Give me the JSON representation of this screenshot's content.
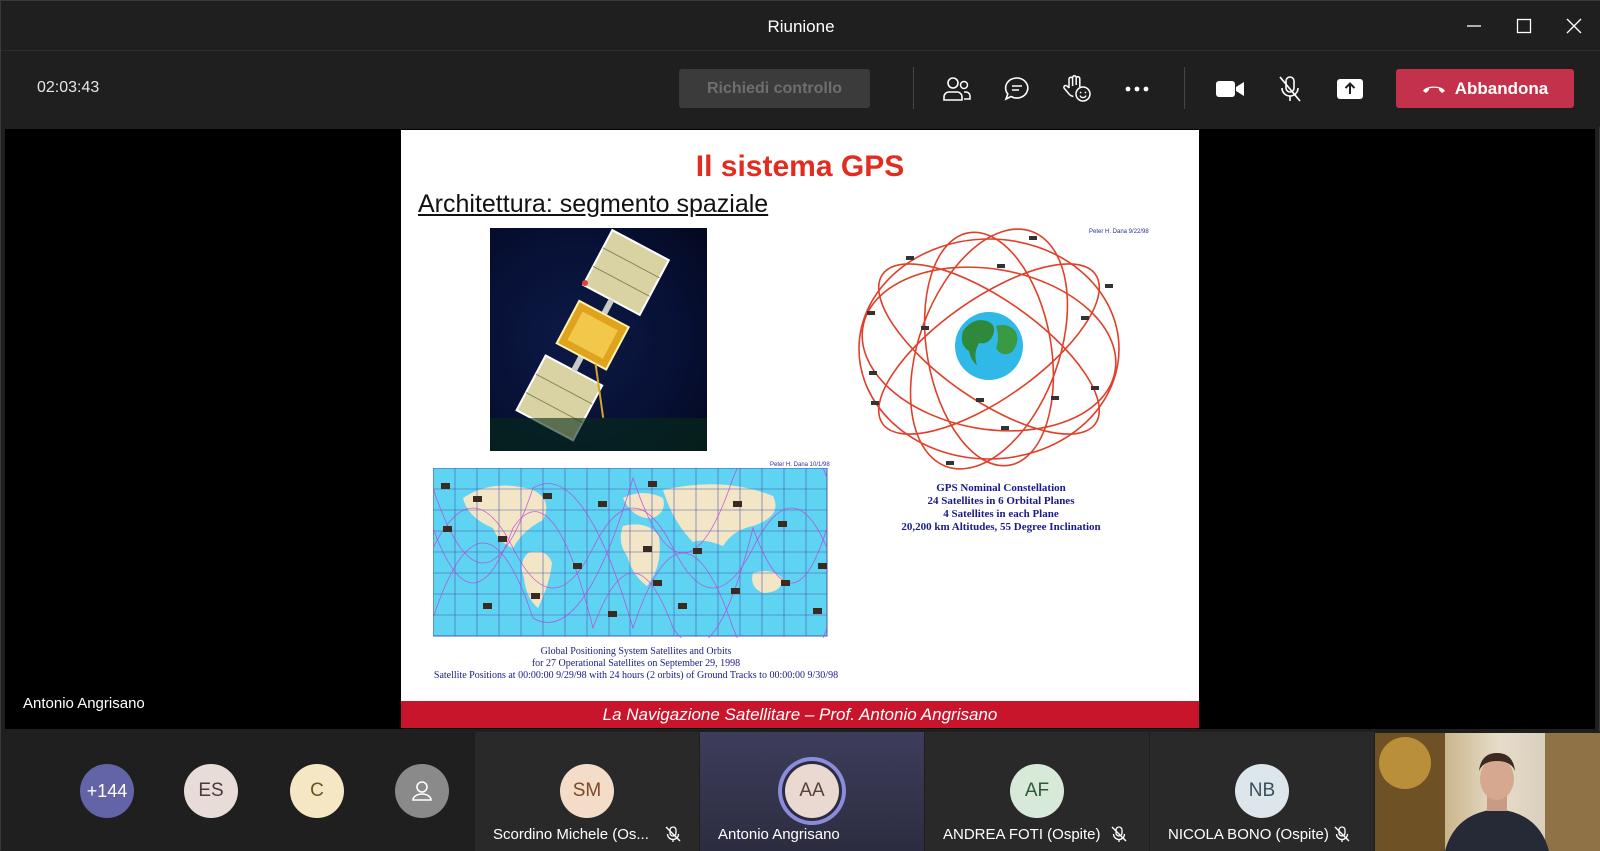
{
  "window": {
    "title": "Riunione"
  },
  "toolbar": {
    "timer": "02:03:43",
    "request_control_label": "Richiedi controllo",
    "leave_label": "Abbandona",
    "icons": [
      "participants-icon",
      "chat-icon",
      "reactions-icon",
      "more-icon",
      "camera-icon",
      "mic-muted-icon",
      "share-icon"
    ]
  },
  "stage": {
    "presenter_name": "Antonio Angrisano",
    "slide": {
      "title": "Il sistema GPS",
      "subtitle": "Architettura: segmento spaziale",
      "orbit_credit": "Peter H. Dana 9/22/98",
      "map_credit": "Peter H. Dana 10/1/98",
      "constellation_caption": [
        "GPS Nominal Constellation",
        "24 Satellites in 6 Orbital Planes",
        "4 Satellites in each Plane",
        "20,200 km Altitudes, 55 Degree Inclination"
      ],
      "map_caption": [
        "Global Positioning System Satellites and Orbits",
        "for 27 Operational Satellites on September 29, 1998",
        "Satellite Positions at 00:00:00 9/29/98 with 24 hours (2 orbits) of Ground Tracks to 00:00:00 9/30/98"
      ],
      "footer": "La Navigazione Satellitare – Prof. Antonio Angrisano"
    }
  },
  "participants": {
    "overflow": {
      "label": "+144",
      "color": "#6264a7"
    },
    "avatars": [
      {
        "initials": "ES",
        "color": "#e8dcd8",
        "text_color": "#4a3a3a"
      },
      {
        "initials": "C",
        "color": "#f5e6c4",
        "text_color": "#6b5320"
      },
      {
        "initials": "",
        "color": "#8a8a8a",
        "icon": "person-icon"
      }
    ],
    "tiles": [
      {
        "initials": "SM",
        "name": "Scordino Michele (Os...",
        "color": "#f3dcc8",
        "text_color": "#7a4a2a",
        "muted": true
      },
      {
        "initials": "AA",
        "name": "Antonio Angrisano",
        "color": "#e9d9d1",
        "text_color": "#5a4040",
        "muted": false,
        "speaking": true
      },
      {
        "initials": "AF",
        "name": "ANDREA FOTI (Ospite)",
        "color": "#d7ead9",
        "text_color": "#2f5a38",
        "muted": true
      },
      {
        "initials": "NB",
        "name": "NICOLA BONO (Ospite)",
        "color": "#dde6ea",
        "text_color": "#3a4f5c",
        "muted": true
      }
    ]
  }
}
